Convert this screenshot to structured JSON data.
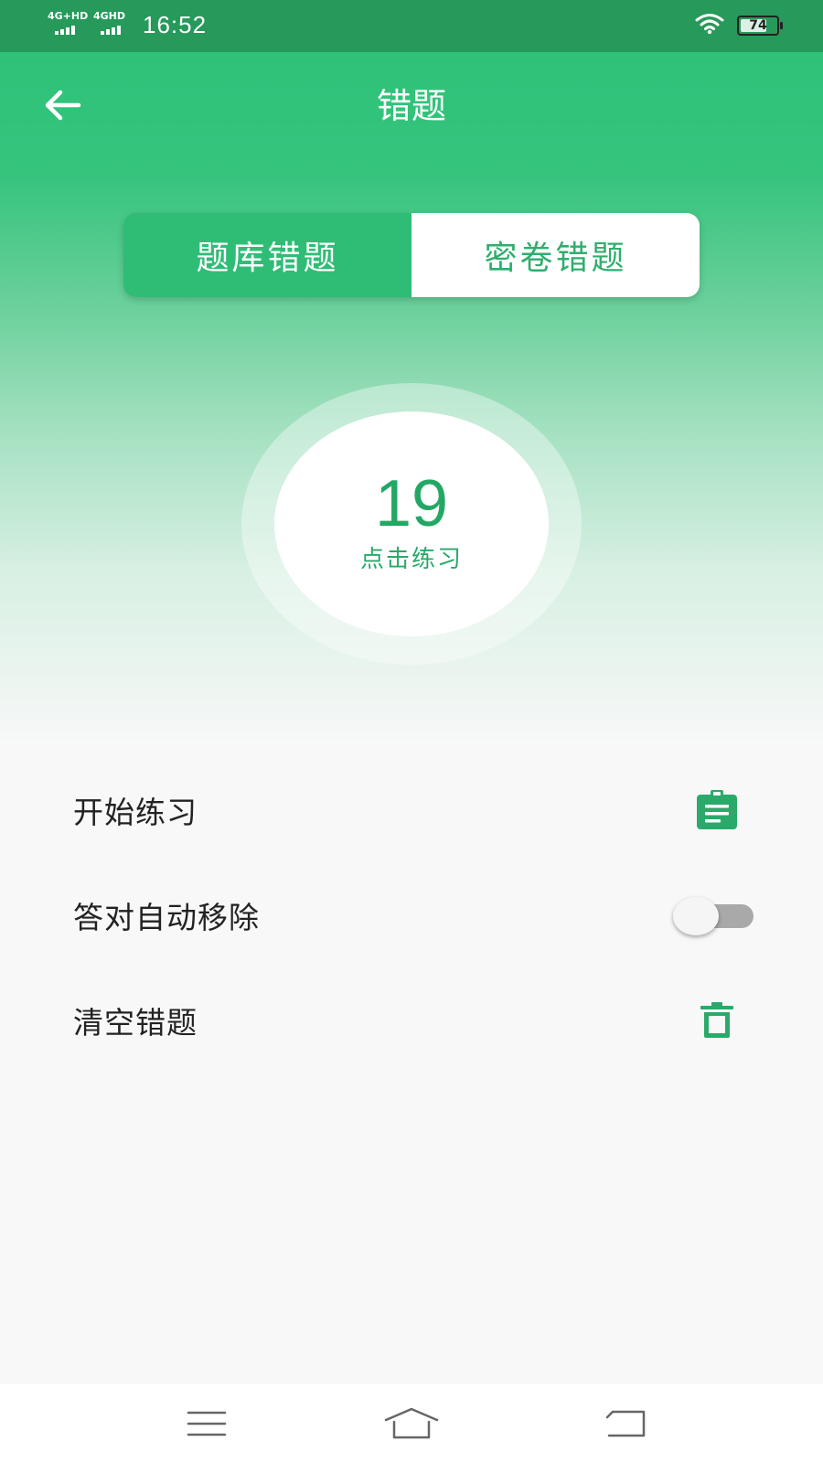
{
  "status_bar": {
    "network_1": "4G+HD",
    "network_2": "4GHD",
    "time": "16:52",
    "battery": "74",
    "battery_level": 0.74
  },
  "header": {
    "title": "错题",
    "back_icon": "arrow-left-icon"
  },
  "tabs": [
    {
      "label": "题库错题",
      "selected": true
    },
    {
      "label": "密卷错题",
      "selected": false
    }
  ],
  "counter": {
    "count": "19",
    "hint": "点击练习"
  },
  "options": {
    "start": {
      "label": "开始练习",
      "icon": "clipboard-icon"
    },
    "auto_remove": {
      "label": "答对自动移除",
      "enabled": false
    },
    "clear": {
      "label": "清空错题",
      "icon": "trash-icon"
    }
  },
  "colors": {
    "primary": "#2fbd76",
    "status_bar": "#27995a",
    "icon_green": "#2aaa6a",
    "toggle_off": "#a9a9a9"
  },
  "nav": {
    "menu_icon": "menu-icon",
    "home_icon": "home-icon",
    "back_icon": "return-icon"
  }
}
